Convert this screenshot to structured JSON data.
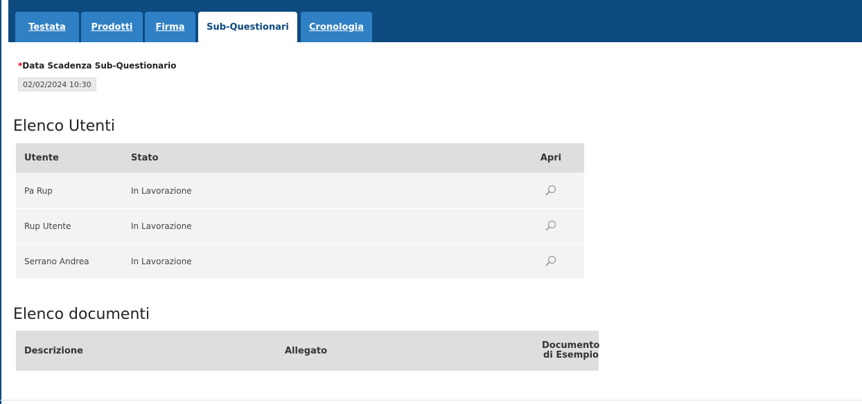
{
  "tabs": [
    {
      "label": "Testata",
      "active": false
    },
    {
      "label": "Prodotti",
      "active": false
    },
    {
      "label": "Firma",
      "active": false
    },
    {
      "label": "Sub-Questionari",
      "active": true
    },
    {
      "label": "Cronologia",
      "active": false
    }
  ],
  "deadline": {
    "required_mark": "*",
    "label": "Data Scadenza Sub-Questionario",
    "value": "02/02/2024 10:30"
  },
  "users_section": {
    "title": "Elenco Utenti",
    "headers": {
      "user": "Utente",
      "status": "Stato",
      "open": "Apri"
    },
    "rows": [
      {
        "user": "Pa Rup",
        "status": "In Lavorazione",
        "open_icon": "magnifier-icon"
      },
      {
        "user": "Rup Utente",
        "status": "In Lavorazione",
        "open_icon": "magnifier-icon"
      },
      {
        "user": "Serrano Andrea",
        "status": "In Lavorazione",
        "open_icon": "magnifier-icon"
      }
    ]
  },
  "documents_section": {
    "title": "Elenco documenti",
    "headers": {
      "description": "Descrizione",
      "attachment": "Allegato",
      "example_line1": "Documento",
      "example_line2": "di Esempio"
    }
  },
  "colors": {
    "header_bg": "#0d4a7f",
    "tab_bg": "#2f80c4",
    "required": "#d0021b"
  }
}
